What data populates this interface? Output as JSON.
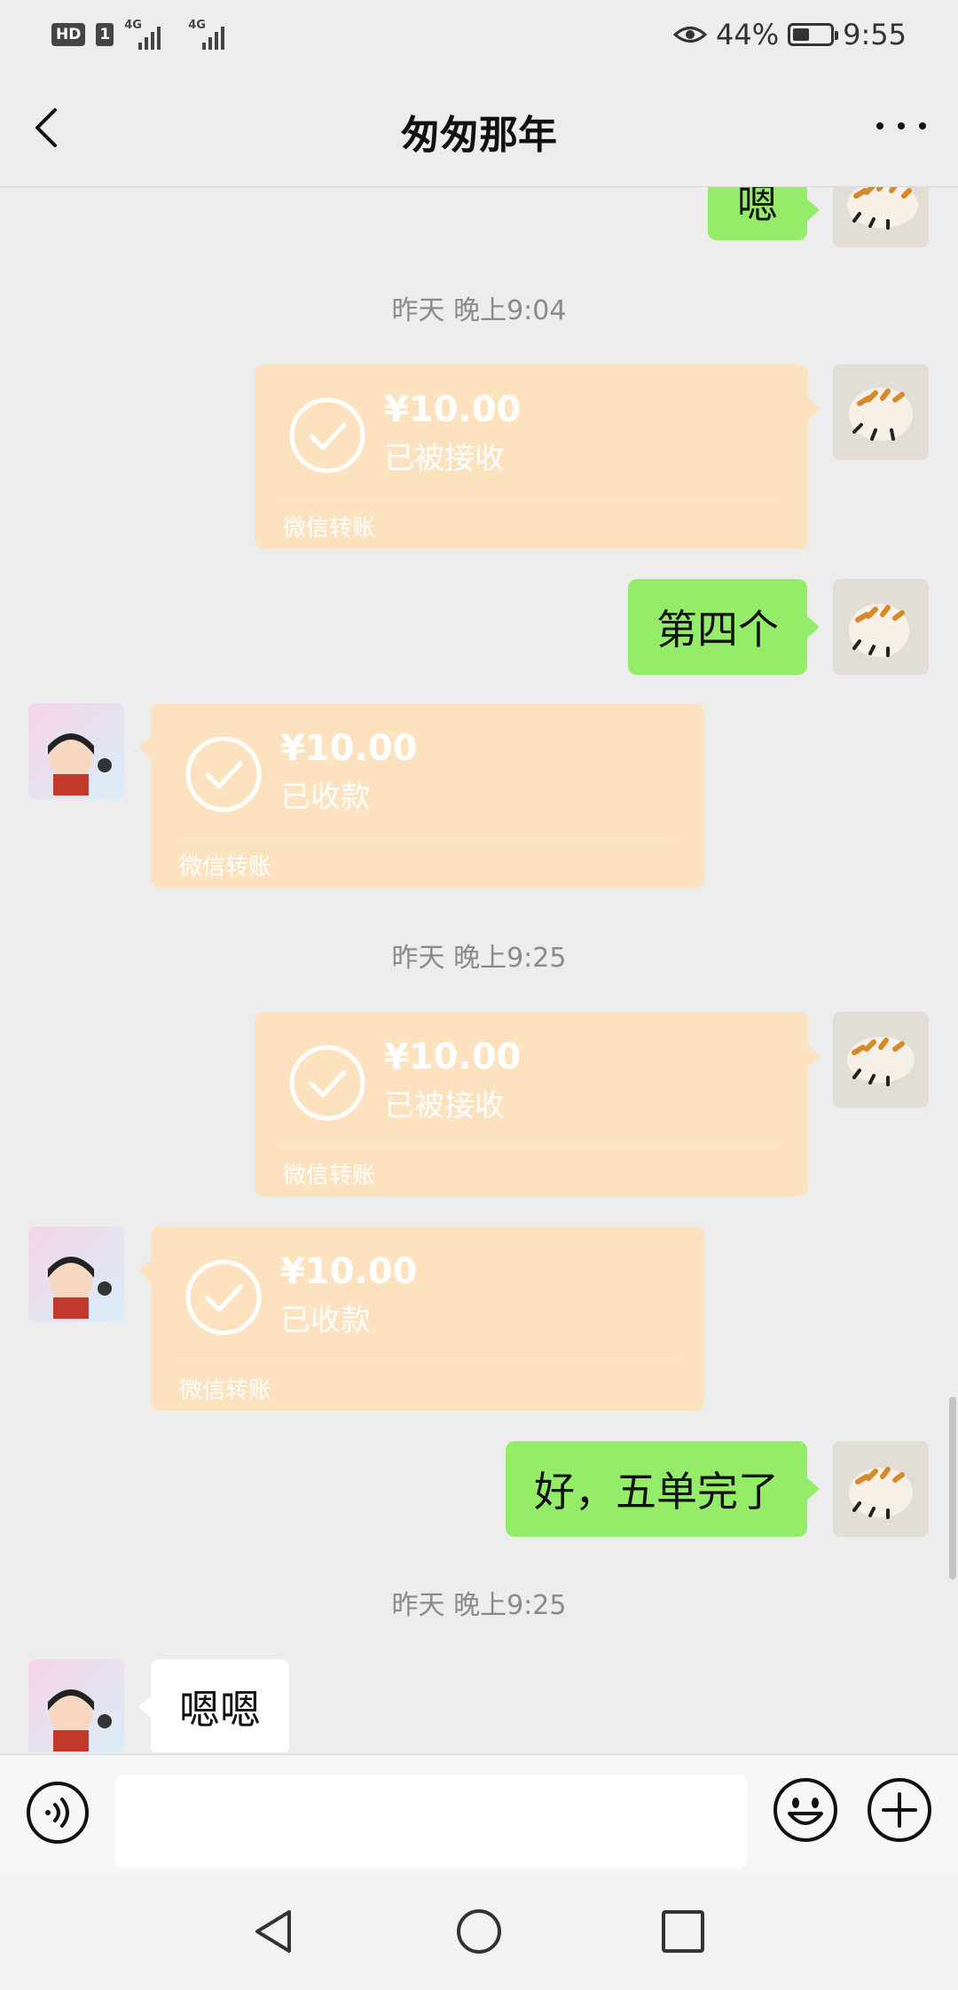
{
  "status_bar": {
    "hd": "HD",
    "sim": "1",
    "network1": "4G",
    "network2": "4G",
    "battery_percent": "44%",
    "battery_level": 0.44,
    "time": "9:55"
  },
  "header": {
    "title": "匆匆那年"
  },
  "messages": {
    "m0": {
      "text": "嗯"
    },
    "t1": "昨天 晚上9:04",
    "tr1": {
      "amount": "¥10.00",
      "status": "已被接收",
      "footer": "微信转账"
    },
    "m2": {
      "text": "第四个"
    },
    "tr2": {
      "amount": "¥10.00",
      "status": "已收款",
      "footer": "微信转账"
    },
    "t2": "昨天 晚上9:25",
    "tr3": {
      "amount": "¥10.00",
      "status": "已被接收",
      "footer": "微信转账"
    },
    "tr4": {
      "amount": "¥10.00",
      "status": "已收款",
      "footer": "微信转账"
    },
    "m5": {
      "text": "好，五单完了"
    },
    "t3": "昨天 晚上9:25",
    "m6": {
      "text": "嗯嗯"
    }
  },
  "input": {
    "value": "",
    "placeholder": ""
  },
  "colors": {
    "background": "#ededed",
    "sent_bubble": "#95ec69",
    "received_bubble": "#ffffff",
    "transfer_card": "#fde2c0"
  },
  "icons": {
    "back": "chevron-left-icon",
    "more": "more-icon",
    "voice": "voice-icon",
    "emoji": "emoji-icon",
    "plus": "plus-icon",
    "check": "check-circle-icon"
  }
}
